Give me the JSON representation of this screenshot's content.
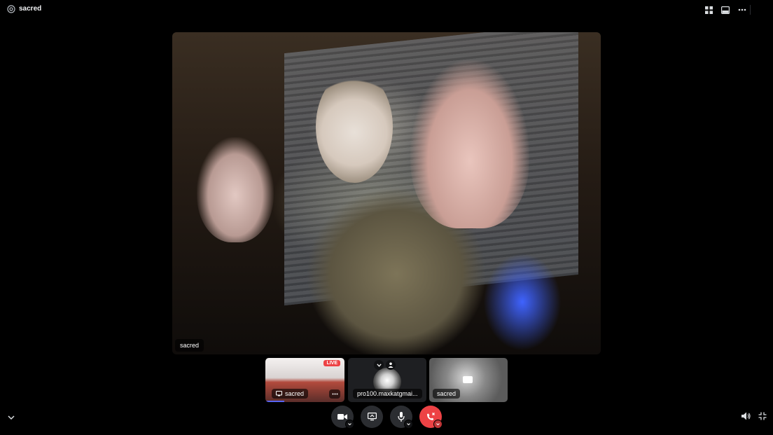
{
  "header": {
    "title": "sacred",
    "icons": [
      "at-icon",
      "grid-icon",
      "inbox-icon",
      "more-icon"
    ]
  },
  "main_video": {
    "name": "sacred"
  },
  "tiles": [
    {
      "name": "sacred",
      "badge": "LIVE",
      "type": "stream",
      "progress": 0.24
    },
    {
      "name": "pro100.maxkatgmai...",
      "type": "avatar"
    },
    {
      "name": "sacred",
      "type": "camera-off"
    }
  ],
  "controls": [
    {
      "name": "camera",
      "icon": "video-camera-icon"
    },
    {
      "name": "screen-share",
      "icon": "screen-share-icon"
    },
    {
      "name": "microphone",
      "icon": "microphone-icon"
    },
    {
      "name": "disconnect",
      "icon": "phone-leave-icon"
    }
  ],
  "colors": {
    "accent": "#5865f2",
    "danger": "#ed4245",
    "button_bg": "#2b2d31"
  }
}
